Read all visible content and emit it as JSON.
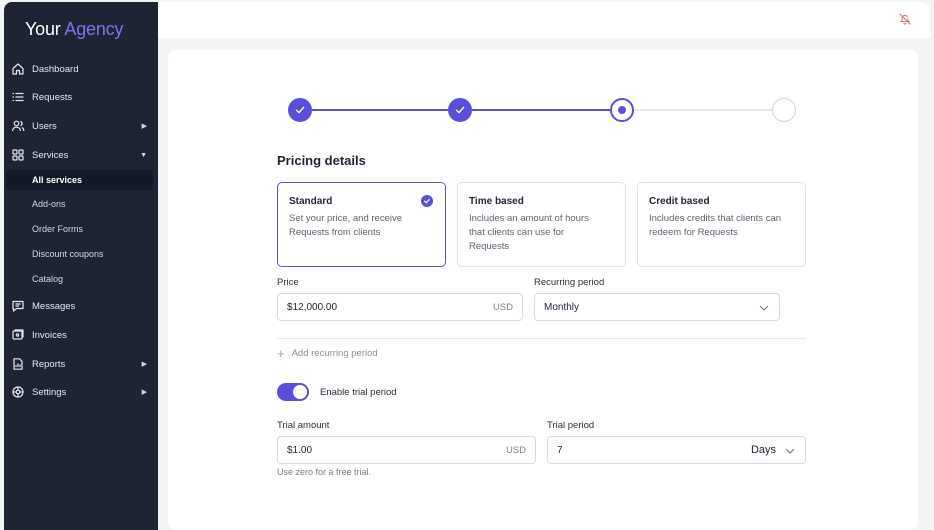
{
  "brand": {
    "part1": "Your",
    "part2": "Agency",
    "accent": "#5b4fd9"
  },
  "sidebar": {
    "items": [
      {
        "label": "Dashboard",
        "icon": "home-icon"
      },
      {
        "label": "Requests",
        "icon": "list-icon"
      },
      {
        "label": "Users",
        "icon": "users-icon",
        "caret": "▶"
      },
      {
        "label": "Services",
        "icon": "grid-icon",
        "caret": "▼"
      },
      {
        "label": "Messages",
        "icon": "message-icon"
      },
      {
        "label": "Invoices",
        "icon": "invoice-icon"
      },
      {
        "label": "Reports",
        "icon": "report-icon",
        "caret": "▶"
      },
      {
        "label": "Settings",
        "icon": "settings-icon",
        "caret": "▶"
      }
    ],
    "services_sub": [
      "All services",
      "Add-ons",
      "Order Forms",
      "Discount coupons",
      "Catalog"
    ],
    "active_sub": "All services"
  },
  "topbar": {
    "icon": "bell-icon"
  },
  "stepper": {
    "steps": [
      "done",
      "done",
      "current",
      "todo"
    ]
  },
  "form": {
    "title": "Pricing details",
    "options": [
      {
        "title": "Standard",
        "desc": "Set your price, and receive Requests from clients",
        "selected": true
      },
      {
        "title": "Time based",
        "desc": "Includes an amount of hours that clients can use for Requests",
        "selected": false
      },
      {
        "title": "Credit based",
        "desc": "Includes credits that clients can redeem for Requests",
        "selected": false
      }
    ],
    "price": {
      "label": "Price",
      "value": "$12,000.00",
      "currency": "USD"
    },
    "recurring": {
      "label": "Recurring period",
      "value": "Monthly"
    },
    "add_recurring": "Add recurring period",
    "trial_toggle": {
      "label": "Enable trial period",
      "on": true
    },
    "trial_amount": {
      "label": "Trial amount",
      "value": "$1.00",
      "currency": "USD"
    },
    "trial_period": {
      "label": "Trial period",
      "value": "7",
      "unit": "Days"
    },
    "hint": "Use zero for a free trial."
  }
}
